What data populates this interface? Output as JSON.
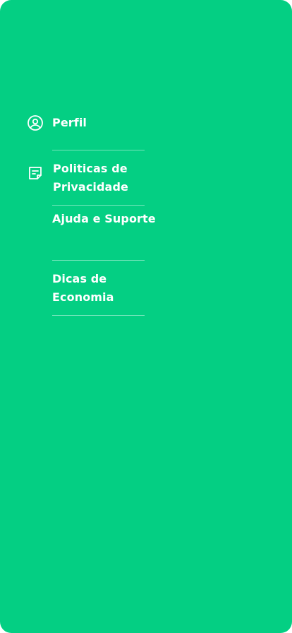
{
  "theme": {
    "background": "#04CF83",
    "text_color": "#FFFFFF"
  },
  "menu": {
    "items": [
      {
        "label": "Perfil",
        "icon": "user-circle-icon"
      },
      {
        "label": "Politicas de Privacidade",
        "icon": "document-icon"
      },
      {
        "label": "Ajuda e Suporte",
        "icon": ""
      },
      {
        "label": "Dicas de Economia",
        "icon": ""
      }
    ]
  }
}
